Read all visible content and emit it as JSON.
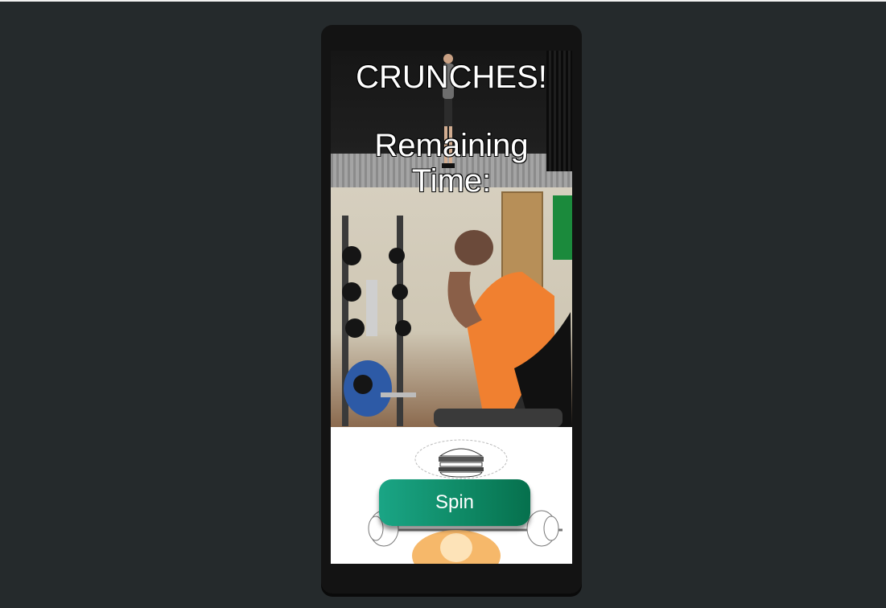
{
  "workout": {
    "exercise_title": "CRUNCHES!",
    "timer_label": "Remaining Time:"
  },
  "game": {
    "spin_label": "Spin",
    "thought_icon": "burger-icon",
    "mascot_icon": "weightlifter-mascot-icon"
  },
  "colors": {
    "page_background": "#252a2c",
    "phone_frame": "#131313",
    "spin_gradient_start": "#1aa585",
    "spin_gradient_end": "#06704d",
    "overlay_text": "#ffffff"
  }
}
